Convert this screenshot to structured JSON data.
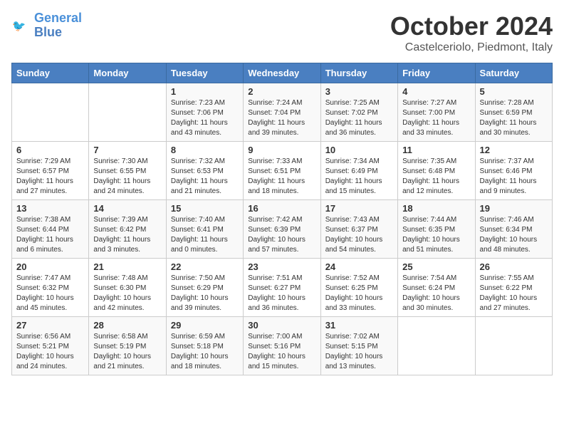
{
  "header": {
    "logo_line1": "General",
    "logo_line2": "Blue",
    "month_title": "October 2024",
    "location": "Castelceriolo, Piedmont, Italy"
  },
  "days_of_week": [
    "Sunday",
    "Monday",
    "Tuesday",
    "Wednesday",
    "Thursday",
    "Friday",
    "Saturday"
  ],
  "weeks": [
    [
      {
        "day": "",
        "sunrise": "",
        "sunset": "",
        "daylight": ""
      },
      {
        "day": "",
        "sunrise": "",
        "sunset": "",
        "daylight": ""
      },
      {
        "day": "1",
        "sunrise": "Sunrise: 7:23 AM",
        "sunset": "Sunset: 7:06 PM",
        "daylight": "Daylight: 11 hours and 43 minutes."
      },
      {
        "day": "2",
        "sunrise": "Sunrise: 7:24 AM",
        "sunset": "Sunset: 7:04 PM",
        "daylight": "Daylight: 11 hours and 39 minutes."
      },
      {
        "day": "3",
        "sunrise": "Sunrise: 7:25 AM",
        "sunset": "Sunset: 7:02 PM",
        "daylight": "Daylight: 11 hours and 36 minutes."
      },
      {
        "day": "4",
        "sunrise": "Sunrise: 7:27 AM",
        "sunset": "Sunset: 7:00 PM",
        "daylight": "Daylight: 11 hours and 33 minutes."
      },
      {
        "day": "5",
        "sunrise": "Sunrise: 7:28 AM",
        "sunset": "Sunset: 6:59 PM",
        "daylight": "Daylight: 11 hours and 30 minutes."
      }
    ],
    [
      {
        "day": "6",
        "sunrise": "Sunrise: 7:29 AM",
        "sunset": "Sunset: 6:57 PM",
        "daylight": "Daylight: 11 hours and 27 minutes."
      },
      {
        "day": "7",
        "sunrise": "Sunrise: 7:30 AM",
        "sunset": "Sunset: 6:55 PM",
        "daylight": "Daylight: 11 hours and 24 minutes."
      },
      {
        "day": "8",
        "sunrise": "Sunrise: 7:32 AM",
        "sunset": "Sunset: 6:53 PM",
        "daylight": "Daylight: 11 hours and 21 minutes."
      },
      {
        "day": "9",
        "sunrise": "Sunrise: 7:33 AM",
        "sunset": "Sunset: 6:51 PM",
        "daylight": "Daylight: 11 hours and 18 minutes."
      },
      {
        "day": "10",
        "sunrise": "Sunrise: 7:34 AM",
        "sunset": "Sunset: 6:49 PM",
        "daylight": "Daylight: 11 hours and 15 minutes."
      },
      {
        "day": "11",
        "sunrise": "Sunrise: 7:35 AM",
        "sunset": "Sunset: 6:48 PM",
        "daylight": "Daylight: 11 hours and 12 minutes."
      },
      {
        "day": "12",
        "sunrise": "Sunrise: 7:37 AM",
        "sunset": "Sunset: 6:46 PM",
        "daylight": "Daylight: 11 hours and 9 minutes."
      }
    ],
    [
      {
        "day": "13",
        "sunrise": "Sunrise: 7:38 AM",
        "sunset": "Sunset: 6:44 PM",
        "daylight": "Daylight: 11 hours and 6 minutes."
      },
      {
        "day": "14",
        "sunrise": "Sunrise: 7:39 AM",
        "sunset": "Sunset: 6:42 PM",
        "daylight": "Daylight: 11 hours and 3 minutes."
      },
      {
        "day": "15",
        "sunrise": "Sunrise: 7:40 AM",
        "sunset": "Sunset: 6:41 PM",
        "daylight": "Daylight: 11 hours and 0 minutes."
      },
      {
        "day": "16",
        "sunrise": "Sunrise: 7:42 AM",
        "sunset": "Sunset: 6:39 PM",
        "daylight": "Daylight: 10 hours and 57 minutes."
      },
      {
        "day": "17",
        "sunrise": "Sunrise: 7:43 AM",
        "sunset": "Sunset: 6:37 PM",
        "daylight": "Daylight: 10 hours and 54 minutes."
      },
      {
        "day": "18",
        "sunrise": "Sunrise: 7:44 AM",
        "sunset": "Sunset: 6:35 PM",
        "daylight": "Daylight: 10 hours and 51 minutes."
      },
      {
        "day": "19",
        "sunrise": "Sunrise: 7:46 AM",
        "sunset": "Sunset: 6:34 PM",
        "daylight": "Daylight: 10 hours and 48 minutes."
      }
    ],
    [
      {
        "day": "20",
        "sunrise": "Sunrise: 7:47 AM",
        "sunset": "Sunset: 6:32 PM",
        "daylight": "Daylight: 10 hours and 45 minutes."
      },
      {
        "day": "21",
        "sunrise": "Sunrise: 7:48 AM",
        "sunset": "Sunset: 6:30 PM",
        "daylight": "Daylight: 10 hours and 42 minutes."
      },
      {
        "day": "22",
        "sunrise": "Sunrise: 7:50 AM",
        "sunset": "Sunset: 6:29 PM",
        "daylight": "Daylight: 10 hours and 39 minutes."
      },
      {
        "day": "23",
        "sunrise": "Sunrise: 7:51 AM",
        "sunset": "Sunset: 6:27 PM",
        "daylight": "Daylight: 10 hours and 36 minutes."
      },
      {
        "day": "24",
        "sunrise": "Sunrise: 7:52 AM",
        "sunset": "Sunset: 6:25 PM",
        "daylight": "Daylight: 10 hours and 33 minutes."
      },
      {
        "day": "25",
        "sunrise": "Sunrise: 7:54 AM",
        "sunset": "Sunset: 6:24 PM",
        "daylight": "Daylight: 10 hours and 30 minutes."
      },
      {
        "day": "26",
        "sunrise": "Sunrise: 7:55 AM",
        "sunset": "Sunset: 6:22 PM",
        "daylight": "Daylight: 10 hours and 27 minutes."
      }
    ],
    [
      {
        "day": "27",
        "sunrise": "Sunrise: 6:56 AM",
        "sunset": "Sunset: 5:21 PM",
        "daylight": "Daylight: 10 hours and 24 minutes."
      },
      {
        "day": "28",
        "sunrise": "Sunrise: 6:58 AM",
        "sunset": "Sunset: 5:19 PM",
        "daylight": "Daylight: 10 hours and 21 minutes."
      },
      {
        "day": "29",
        "sunrise": "Sunrise: 6:59 AM",
        "sunset": "Sunset: 5:18 PM",
        "daylight": "Daylight: 10 hours and 18 minutes."
      },
      {
        "day": "30",
        "sunrise": "Sunrise: 7:00 AM",
        "sunset": "Sunset: 5:16 PM",
        "daylight": "Daylight: 10 hours and 15 minutes."
      },
      {
        "day": "31",
        "sunrise": "Sunrise: 7:02 AM",
        "sunset": "Sunset: 5:15 PM",
        "daylight": "Daylight: 10 hours and 13 minutes."
      },
      {
        "day": "",
        "sunrise": "",
        "sunset": "",
        "daylight": ""
      },
      {
        "day": "",
        "sunrise": "",
        "sunset": "",
        "daylight": ""
      }
    ]
  ]
}
